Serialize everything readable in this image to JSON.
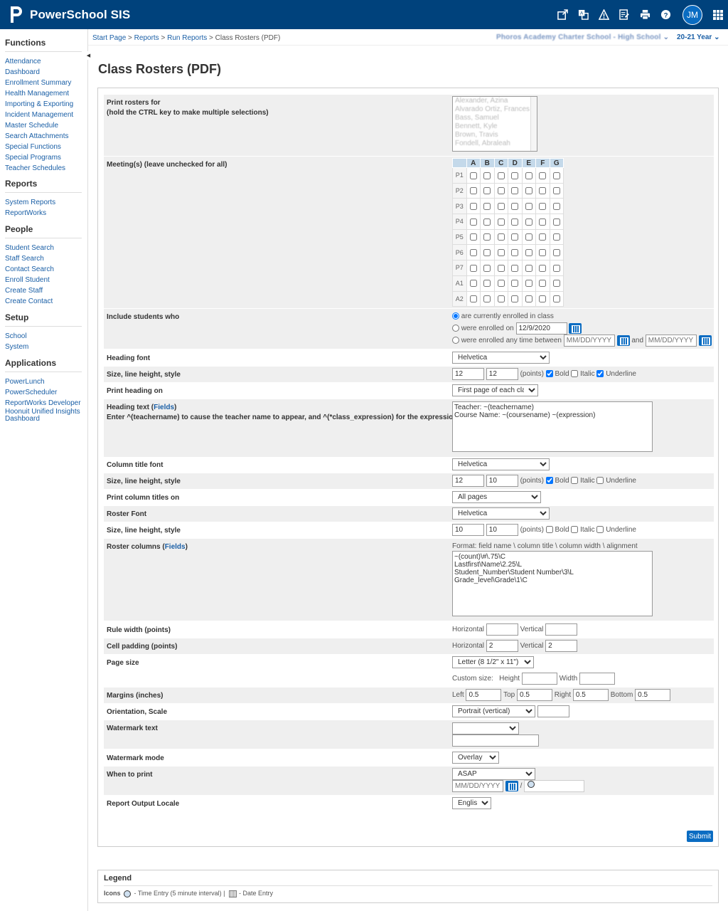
{
  "app": {
    "name": "PowerSchool SIS",
    "avatar": "JM"
  },
  "colors": {
    "topbar": "#00427c",
    "accent": "#0a6cc2",
    "link": "#1a5fa6",
    "row_bg": "#efefef"
  },
  "icons": [
    "new-window-icon",
    "translate-icon",
    "alert-icon",
    "checklist-icon",
    "print-icon",
    "help-icon"
  ],
  "sidebar": {
    "sections": [
      {
        "title": "Functions",
        "items": [
          "Attendance",
          "Dashboard",
          "Enrollment Summary",
          "Health Management",
          "Importing & Exporting",
          "Incident Management",
          "Master Schedule",
          "Search Attachments",
          "Special Functions",
          "Special Programs",
          "Teacher Schedules"
        ]
      },
      {
        "title": "Reports",
        "items": [
          "System Reports",
          "ReportWorks"
        ]
      },
      {
        "title": "People",
        "items": [
          "Student Search",
          "Staff Search",
          "Contact Search",
          "Enroll Student",
          "Create Staff",
          "Create Contact"
        ]
      },
      {
        "title": "Setup",
        "items": [
          "School",
          "System"
        ]
      },
      {
        "title": "Applications",
        "items": [
          "PowerLunch",
          "PowerScheduler",
          "ReportWorks Developer",
          "Hoonuit Unified Insights Dashboard"
        ]
      }
    ]
  },
  "breadcrumb": {
    "items": [
      "Start Page",
      "Reports",
      "Run Reports"
    ],
    "current": "Class Rosters (PDF)",
    "sep": ">"
  },
  "school_selector": "Phoros Academy Charter School - High School",
  "year_selector": "20-21 Year",
  "page_title": "Class Rosters (PDF)",
  "form": {
    "print_rosters_label": "Print rosters for",
    "print_rosters_hint": "(hold the CTRL key to make multiple selections)",
    "teachers": [
      "Alexander, Azina",
      "Alvarado Ortiz, Frances",
      "Bass, Samuel",
      "Bennett, Kyle",
      "Brown, Travis",
      "Fondell, Abraleah"
    ],
    "meetings_label": "Meeting(s) (leave unchecked for all)",
    "meeting_cols": [
      "A",
      "B",
      "C",
      "D",
      "E",
      "F",
      "G"
    ],
    "meeting_rows": [
      "P1",
      "P2",
      "P3",
      "P4",
      "P5",
      "P6",
      "P7",
      "A1",
      "A2"
    ],
    "include_label": "Include students who",
    "opt_current": "are currently enrolled in class",
    "opt_enrolled_on": "were enrolled on",
    "enrolled_on_value": "12/9/2020",
    "opt_between": "were enrolled any time between",
    "date_placeholder": "MM/DD/YYYY",
    "and": "and",
    "heading_font_label": "Heading font",
    "heading_font": "Helvetica",
    "size_label": "Size, line height, style",
    "heading_size": "12",
    "heading_line": "12",
    "points": "(points)",
    "bold": "Bold",
    "italic": "Italic",
    "underline": "Underline",
    "print_heading_label": "Print heading on",
    "print_heading": "First page of each class",
    "heading_text_label": "Heading text",
    "fields_link": "Fields",
    "heading_text_hint": "Enter ^(teachername) to cause the teacher name to appear, and ^(*class_expression) for the expression",
    "heading_text_line1": "Teacher: ~(teachername)",
    "heading_text_line2": "Course Name: ~(coursename) ~(expression)",
    "col_title_font_label": "Column title font",
    "col_title_font": "Helvetica",
    "col_size": "12",
    "col_line": "10",
    "print_col_label": "Print column titles on",
    "print_col": "All pages",
    "roster_font_label": "Roster Font",
    "roster_font": "Helvetica",
    "roster_size": "10",
    "roster_line": "10",
    "roster_columns_label": "Roster columns",
    "format_hint": "Format:   field name \\ column title \\ column width \\ alignment",
    "roster_col_lines": [
      "~(count)\\#\\.75\\C",
      "Lastfirst\\Name\\2.25\\L",
      "Student_Number\\Student Number\\3\\L",
      "Grade_level\\Grade\\1\\C"
    ],
    "rule_width_label": "Rule width (points)",
    "horizontal": "Horizontal",
    "vertical": "Vertical",
    "cell_padding_label": "Cell padding (points)",
    "cell_pad_h": "2",
    "cell_pad_v": "2",
    "page_size_label": "Page size",
    "page_size": "Letter (8 1/2\" x 11\")",
    "custom_size": "Custom size:",
    "height": "Height",
    "width": "Width",
    "margins_label": "Margins (inches)",
    "left": "Left",
    "top": "Top",
    "right": "Right",
    "bottom": "Bottom",
    "margin_left": "0.5",
    "margin_top": "0.5",
    "margin_right": "0.5",
    "margin_bottom": "0.5",
    "orientation_label": "Orientation, Scale",
    "orientation": "Portrait (vertical)",
    "watermark_text_label": "Watermark text",
    "watermark_mode_label": "Watermark mode",
    "watermark_mode": "Overlay",
    "when_label": "When to print",
    "when": "ASAP",
    "slash": "/",
    "locale_label": "Report Output Locale",
    "locale": "English",
    "submit": "Submit"
  },
  "legend": {
    "title": "Legend",
    "icons_label": "Icons",
    "time_entry": "- Time Entry (5 minute interval)",
    "sep": "|",
    "date_entry": "- Date Entry"
  }
}
